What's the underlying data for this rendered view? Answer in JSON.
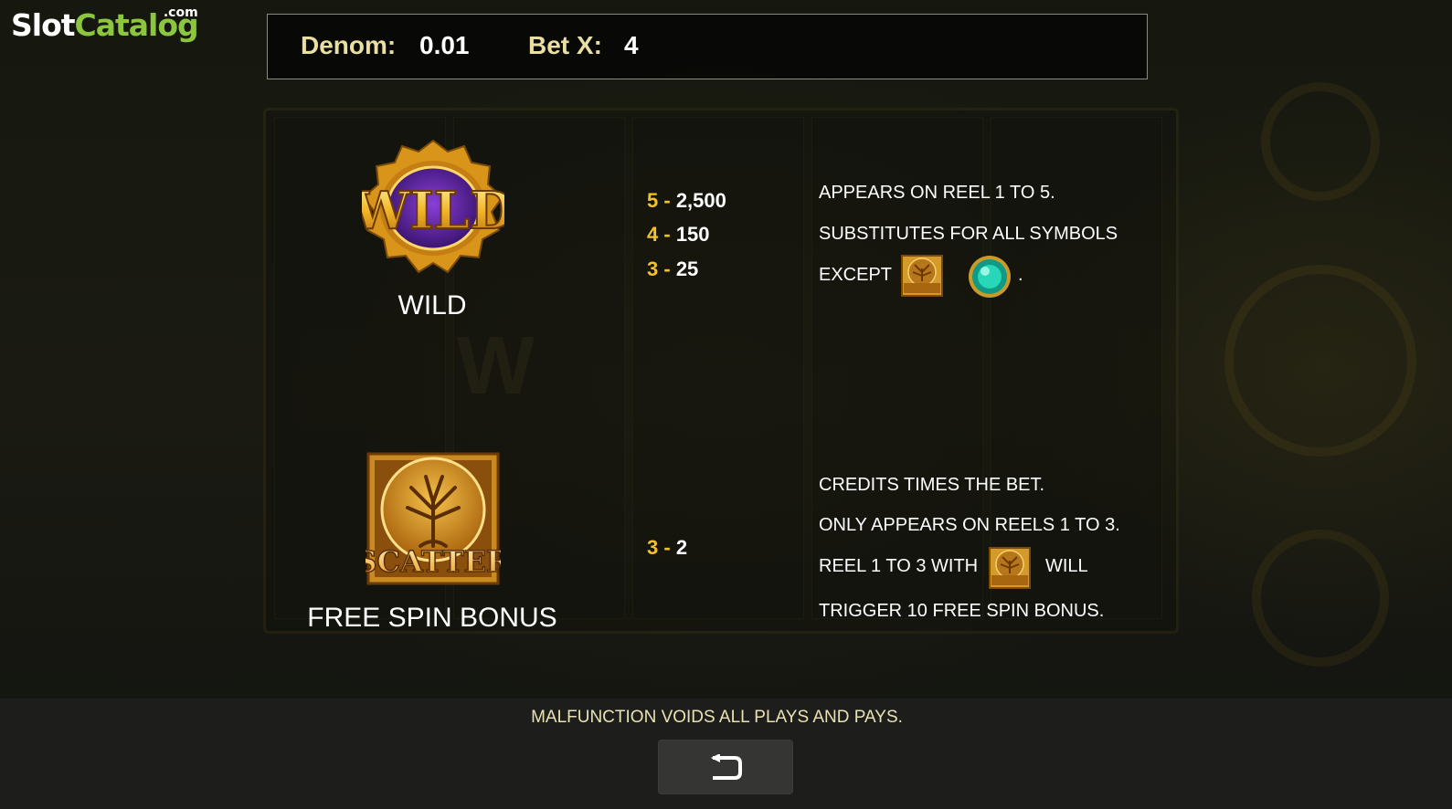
{
  "logo": {
    "part1": "Slot",
    "part2": "Catalog",
    "suffix": ".com"
  },
  "header": {
    "denom_label": "Denom:",
    "denom_value": "0.01",
    "betx_label": "Bet X:",
    "betx_value": "4"
  },
  "wild": {
    "icon_text": "WILD",
    "name": "WILD",
    "pays": [
      {
        "count": "5",
        "sep": " - ",
        "value": "2,500"
      },
      {
        "count": "4",
        "sep": " - ",
        "value": "150"
      },
      {
        "count": "3",
        "sep": " - ",
        "value": "25"
      }
    ],
    "desc_line1": "APPEARS ON REEL 1 TO 5.",
    "desc_line2": "SUBSTITUTES FOR ALL SYMBOLS",
    "desc_line3_prefix": "EXCEPT",
    "desc_line3_suffix": "."
  },
  "scatter": {
    "icon_text": "SCATTER",
    "name": "FREE SPIN BONUS",
    "pays": [
      {
        "count": "3",
        "sep": " - ",
        "value": "2"
      }
    ],
    "desc_line1": "CREDITS TIMES THE BET.",
    "desc_line2": "ONLY APPEARS ON REELS 1 TO 3.",
    "desc_line3_prefix": "REEL 1 TO 3 WITH",
    "desc_line3_suffix": "WILL",
    "desc_line4": "TRIGGER 10 FREE SPIN BONUS."
  },
  "footer": {
    "note": "MALFUNCTION VOIDS ALL PLAYS AND PAYS.",
    "back_icon": "return-arrow-icon"
  },
  "colors": {
    "pay_count": "#f2c22c",
    "header_label": "#e8dfa0",
    "logo_green": "#8cc63f"
  }
}
